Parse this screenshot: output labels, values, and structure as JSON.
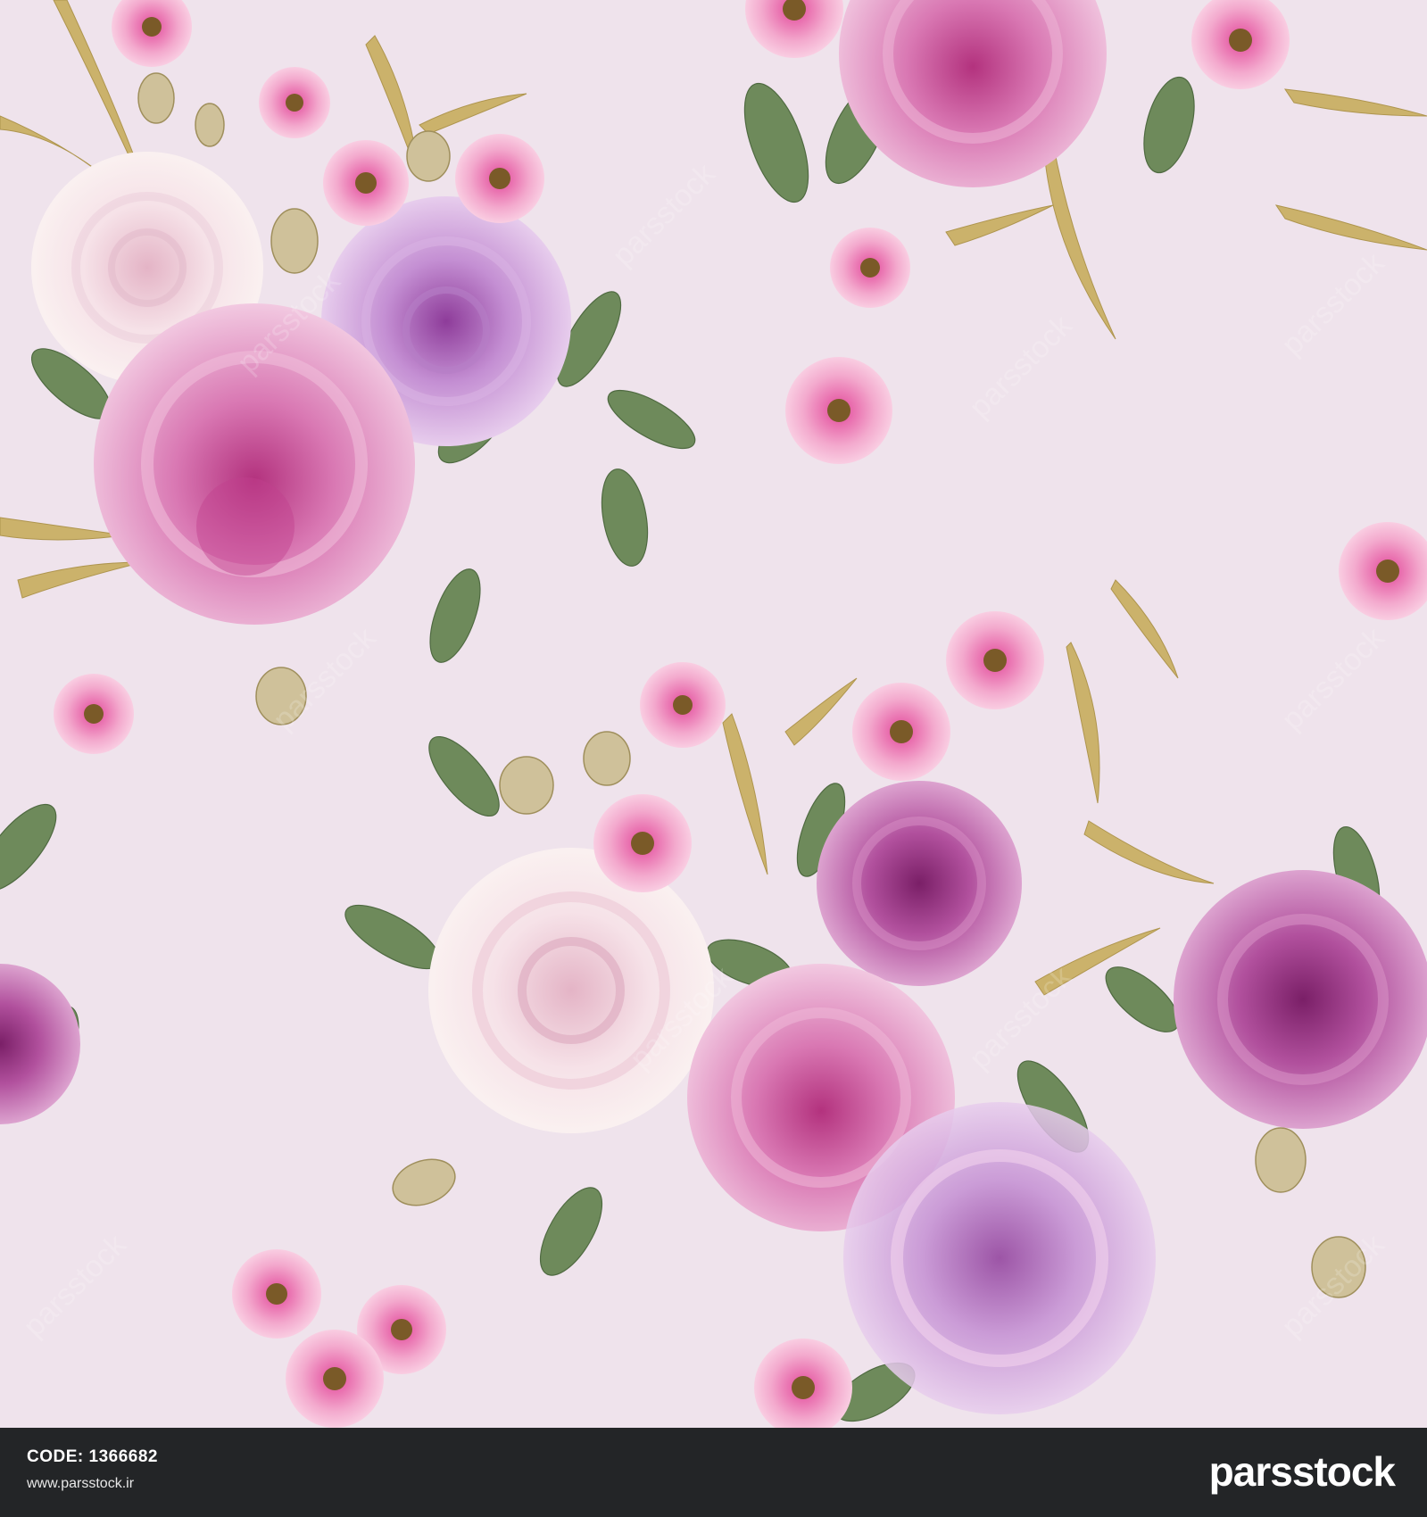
{
  "image": {
    "background_color": "#efe3ec",
    "subject": [
      "roses",
      "peonies",
      "small pink blossoms",
      "green leaves",
      "golden willow leaves"
    ],
    "watermark_text": "parsstock"
  },
  "footer": {
    "code_label": "CODE:",
    "code_value": "1366682",
    "url": "www.parsstock.ir",
    "brand": "parsstock",
    "background_color": "#232527"
  }
}
